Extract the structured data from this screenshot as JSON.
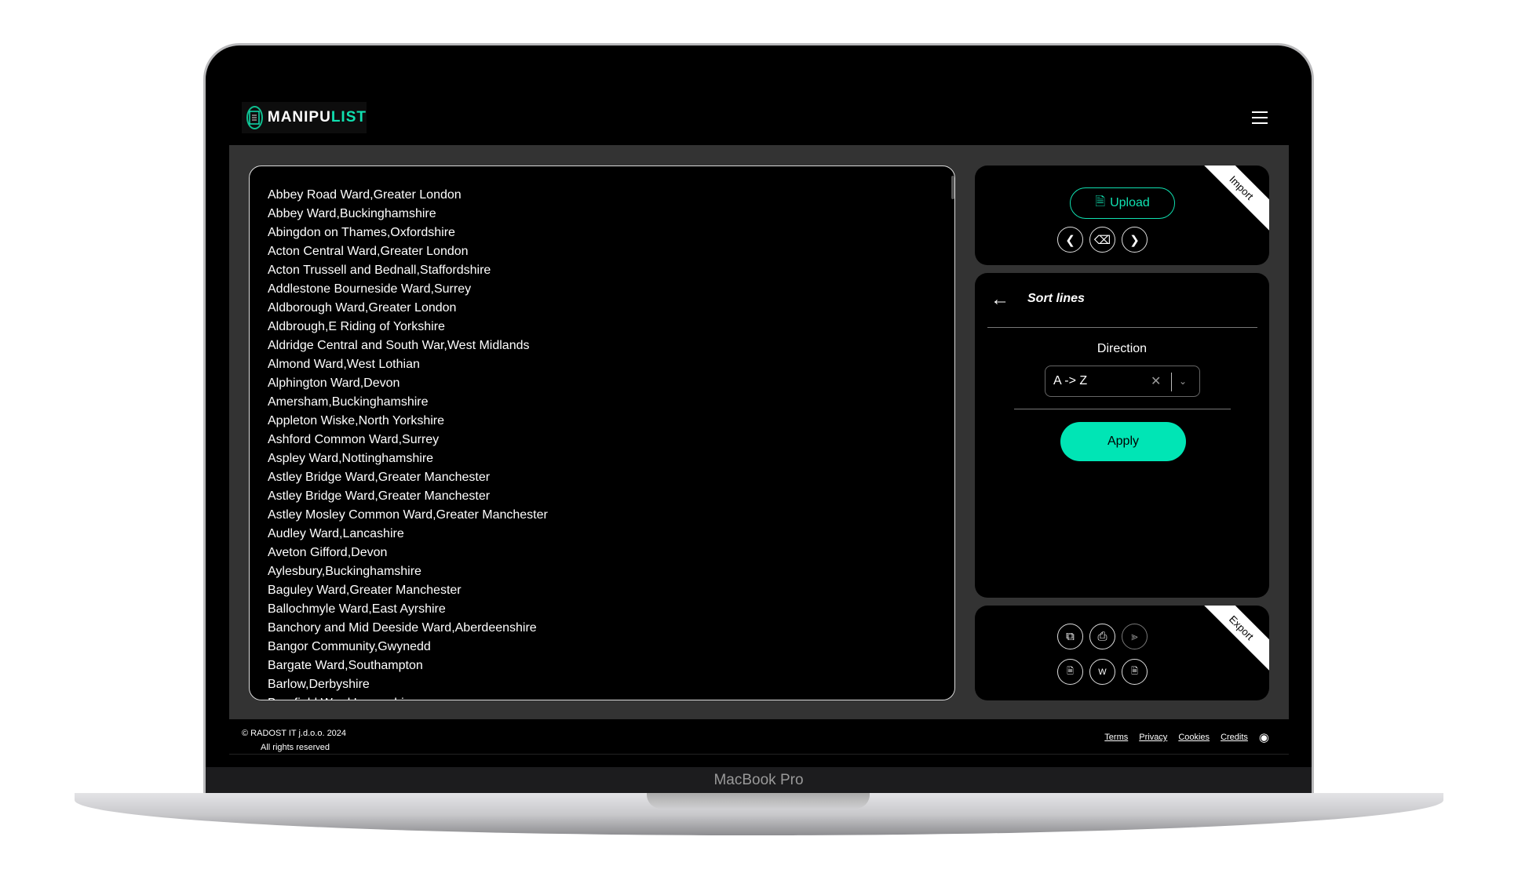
{
  "app": {
    "logo_main": "MANIPU",
    "logo_accent": "LIST"
  },
  "list_lines": [
    "Abbey Road Ward,Greater London",
    "Abbey Ward,Buckinghamshire",
    "Abingdon on Thames,Oxfordshire",
    "Acton Central Ward,Greater London",
    "Acton Trussell and Bednall,Staffordshire",
    "Addlestone Bourneside Ward,Surrey",
    "Aldborough Ward,Greater London",
    "Aldbrough,E Riding of Yorkshire",
    "Aldridge Central and South War,West Midlands",
    "Almond Ward,West Lothian",
    "Alphington Ward,Devon",
    "Amersham,Buckinghamshire",
    "Appleton Wiske,North Yorkshire",
    "Ashford Common Ward,Surrey",
    "Aspley Ward,Nottinghamshire",
    "Astley Bridge Ward,Greater Manchester",
    "Astley Bridge Ward,Greater Manchester",
    "Astley Mosley Common Ward,Greater Manchester",
    "Audley Ward,Lancashire",
    "Aveton Gifford,Devon",
    "Aylesbury,Buckinghamshire",
    "Baguley Ward,Greater Manchester",
    "Ballochmyle Ward,East Ayrshire",
    "Banchory and Mid Deeside Ward,Aberdeenshire",
    "Bangor Community,Gwynedd",
    "Bargate Ward,Southampton",
    "Barlow,Derbyshire",
    "Barnfield Ward,Lancashire"
  ],
  "import_panel": {
    "ribbon": "Import",
    "upload_label": "Upload"
  },
  "sort_panel": {
    "title": "Sort lines",
    "direction_label": "Direction",
    "direction_value": "A -> Z",
    "apply_label": "Apply"
  },
  "export_panel": {
    "ribbon": "Export"
  },
  "footer": {
    "copyright": "© RADOST IT j.d.o.o. 2024",
    "rights": "All rights reserved",
    "links": [
      "Terms",
      "Privacy",
      "Cookies",
      "Credits"
    ]
  },
  "device_label": "MacBook Pro",
  "colors": {
    "accent": "#00e5b5",
    "background": "#000000",
    "workspace": "#333333"
  }
}
